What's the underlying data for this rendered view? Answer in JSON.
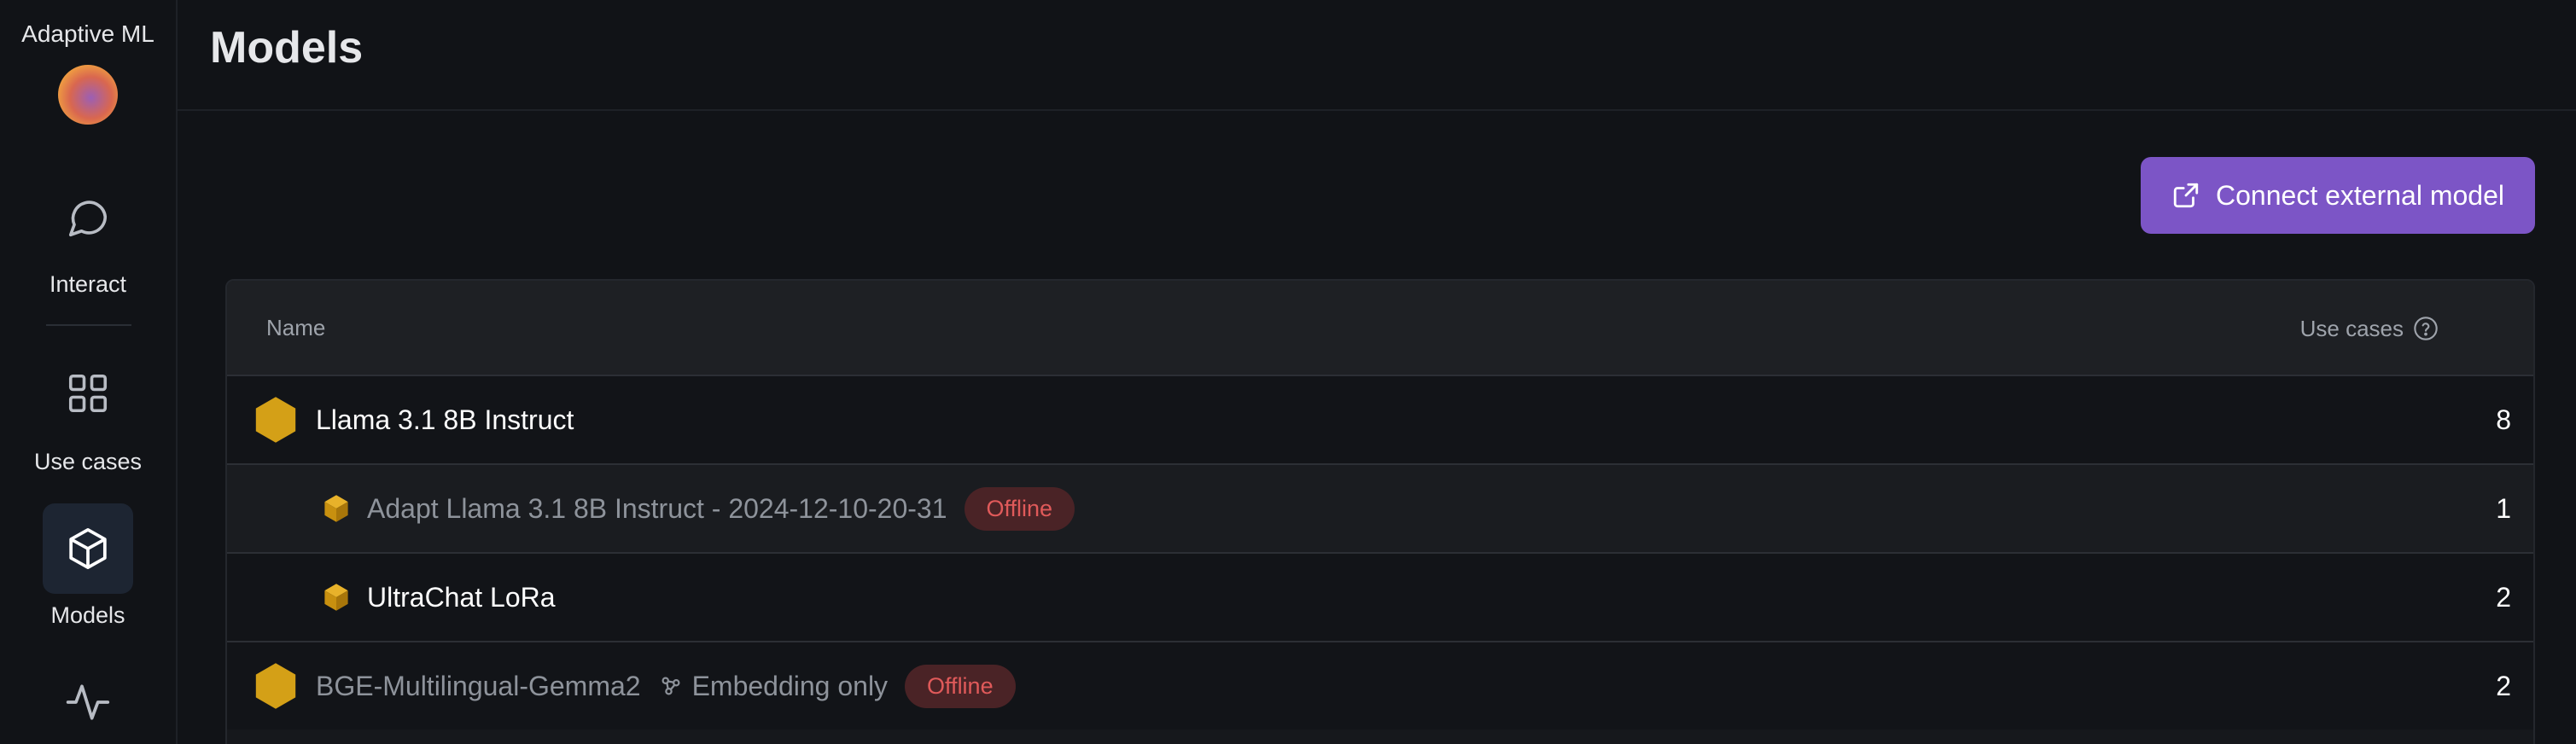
{
  "sidebar": {
    "brand": "Adaptive ML",
    "items": [
      {
        "label": "Interact",
        "icon": "chat-bubble-icon"
      },
      {
        "label": "Use cases",
        "icon": "grid-icon"
      },
      {
        "label": "Models",
        "icon": "cube-icon",
        "active": true
      },
      {
        "label": "",
        "icon": "activity-icon"
      }
    ]
  },
  "header": {
    "title": "Models"
  },
  "actions": {
    "connect_label": "Connect external model"
  },
  "table": {
    "columns": {
      "name": "Name",
      "use_cases": "Use cases"
    },
    "rows": [
      {
        "name": "Llama 3.1 8B Instruct",
        "count": "8",
        "level": 0
      },
      {
        "name": "Adapt Llama 3.1 8B Instruct - 2024-12-10-20-31",
        "status": "Offline",
        "count": "1",
        "level": 1
      },
      {
        "name": "UltraChat LoRa",
        "count": "2",
        "level": 1
      },
      {
        "name": "BGE-Multilingual-Gemma2",
        "tag": "Embedding only",
        "status": "Offline",
        "count": "2",
        "level": 0
      }
    ]
  },
  "colors": {
    "accent": "#7c55c6",
    "offline": "#e05a5a",
    "model_icon": "#d4a017"
  }
}
